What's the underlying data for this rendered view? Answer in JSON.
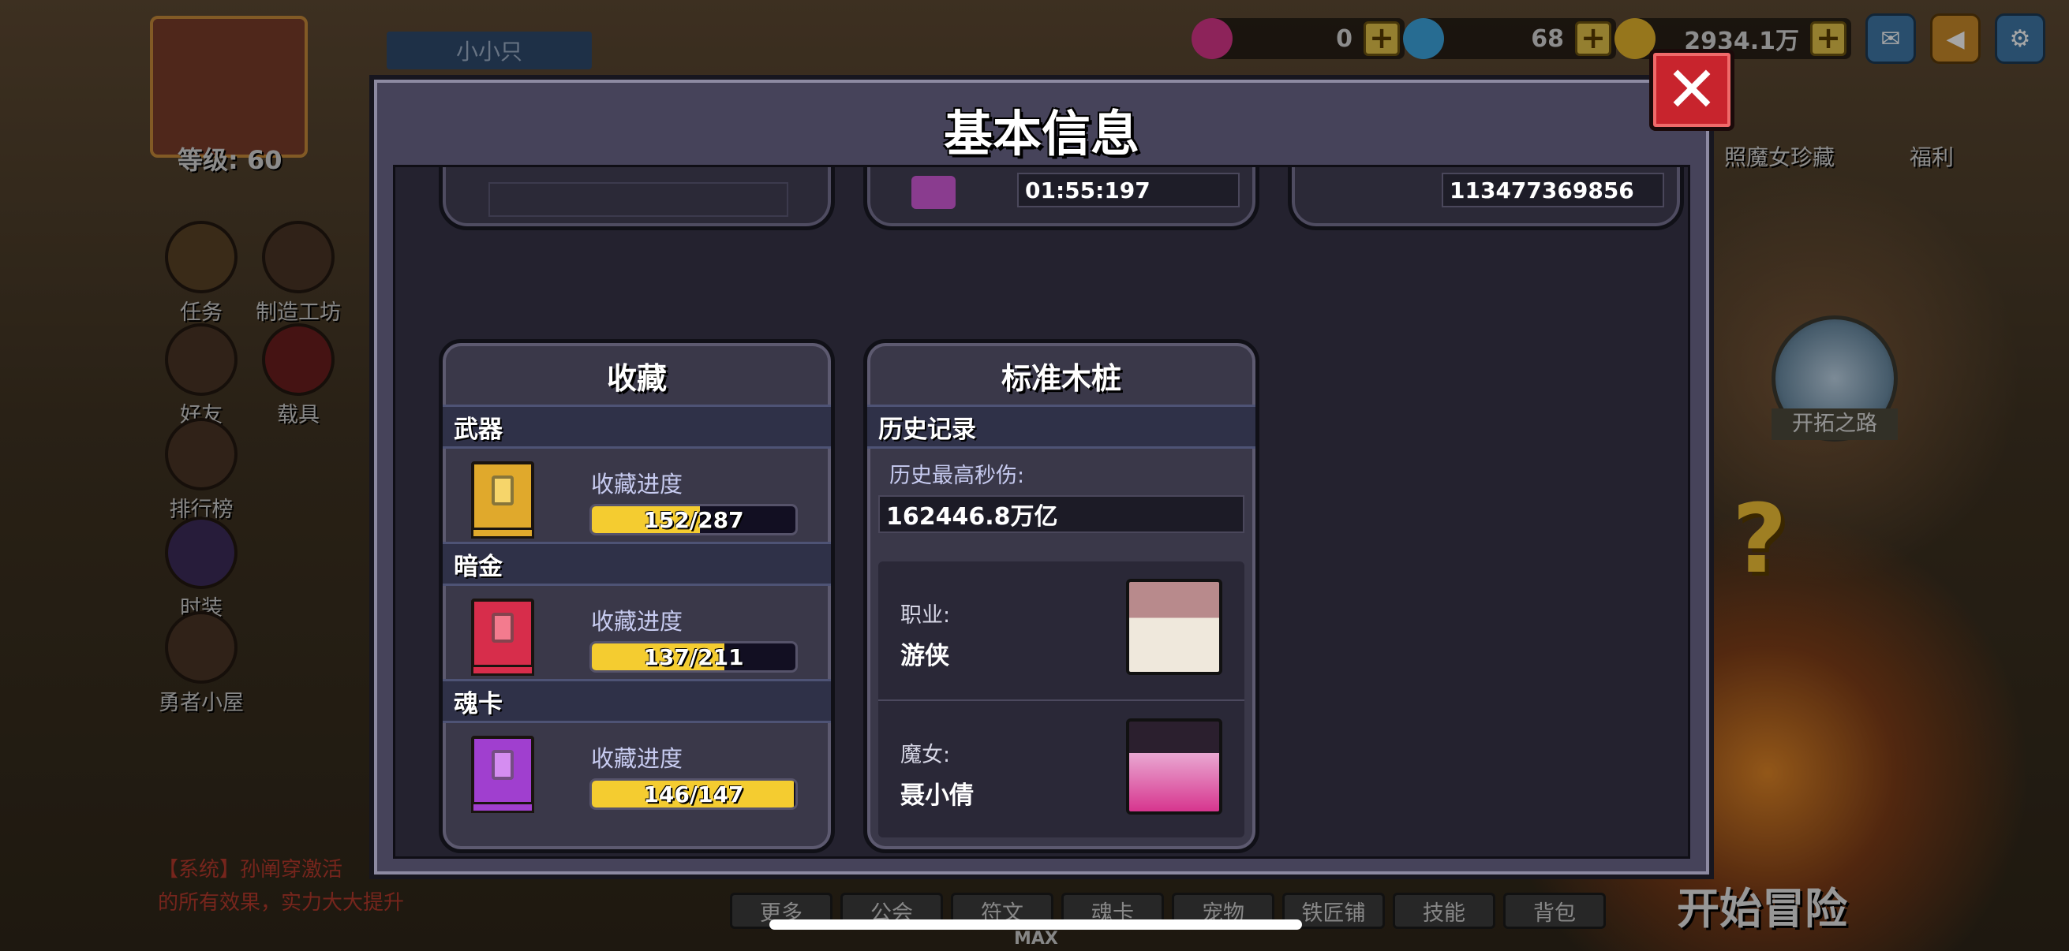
{
  "hud": {
    "player_name": "小小只",
    "level": "等级: 60",
    "left_items": [
      "任务",
      "制造工坊",
      "好友",
      "载具",
      "排行榜",
      "时装",
      "勇者小屋"
    ],
    "chat_line1": "【系统】孙阐穿激活",
    "chat_line2": "的所有效果，实力大大提升"
  },
  "resources": [
    {
      "name": "pink-gem",
      "value": "0",
      "color": "#d9368a"
    },
    {
      "name": "diamond",
      "value": "68",
      "color": "#3da7e0"
    },
    {
      "name": "gold-coin",
      "value": "2934.1万",
      "color": "#e7b62c"
    }
  ],
  "top_icons": [
    "mail-icon",
    "megaphone-icon",
    "settings-icon"
  ],
  "right_hud": {
    "treasure_label": "照魔女珍藏",
    "welfare_label": "福利",
    "path_label": "开拓之路",
    "start_label": "开始冒险"
  },
  "bottom_nav": [
    "更多",
    "公会",
    "符文",
    "魂卡",
    "宠物",
    "铁匠铺",
    "技能",
    "背包"
  ],
  "max_label": "MAX",
  "modal": {
    "title": "基本信息",
    "close_symbol": "✕",
    "top_stubs": {
      "middle_value": "01:55:197",
      "right_value": "113477369856"
    },
    "collection": {
      "title": "收藏",
      "items": [
        {
          "section": "武器",
          "progress_label": "收藏进度",
          "current": 152,
          "total": 287,
          "text": "152/287",
          "book_color": "#e0a92c",
          "gem_color": "#f6d56a"
        },
        {
          "section": "暗金",
          "progress_label": "收藏进度",
          "current": 137,
          "total": 211,
          "text": "137/211",
          "book_color": "#d72d4b",
          "gem_color": "#f37b8e"
        },
        {
          "section": "魂卡",
          "progress_label": "收藏进度",
          "current": 146,
          "total": 147,
          "text": "146/147",
          "book_color": "#a03fcf",
          "gem_color": "#d58df1"
        }
      ]
    },
    "dummy": {
      "title": "标准木桩",
      "history_header": "历史记录",
      "max_dps_label": "历史最高秒伤:",
      "max_dps_value": "162446.8万亿",
      "class_label": "职业:",
      "class_value": "游侠",
      "witch_label": "魔女:",
      "witch_value": "聂小倩"
    }
  }
}
